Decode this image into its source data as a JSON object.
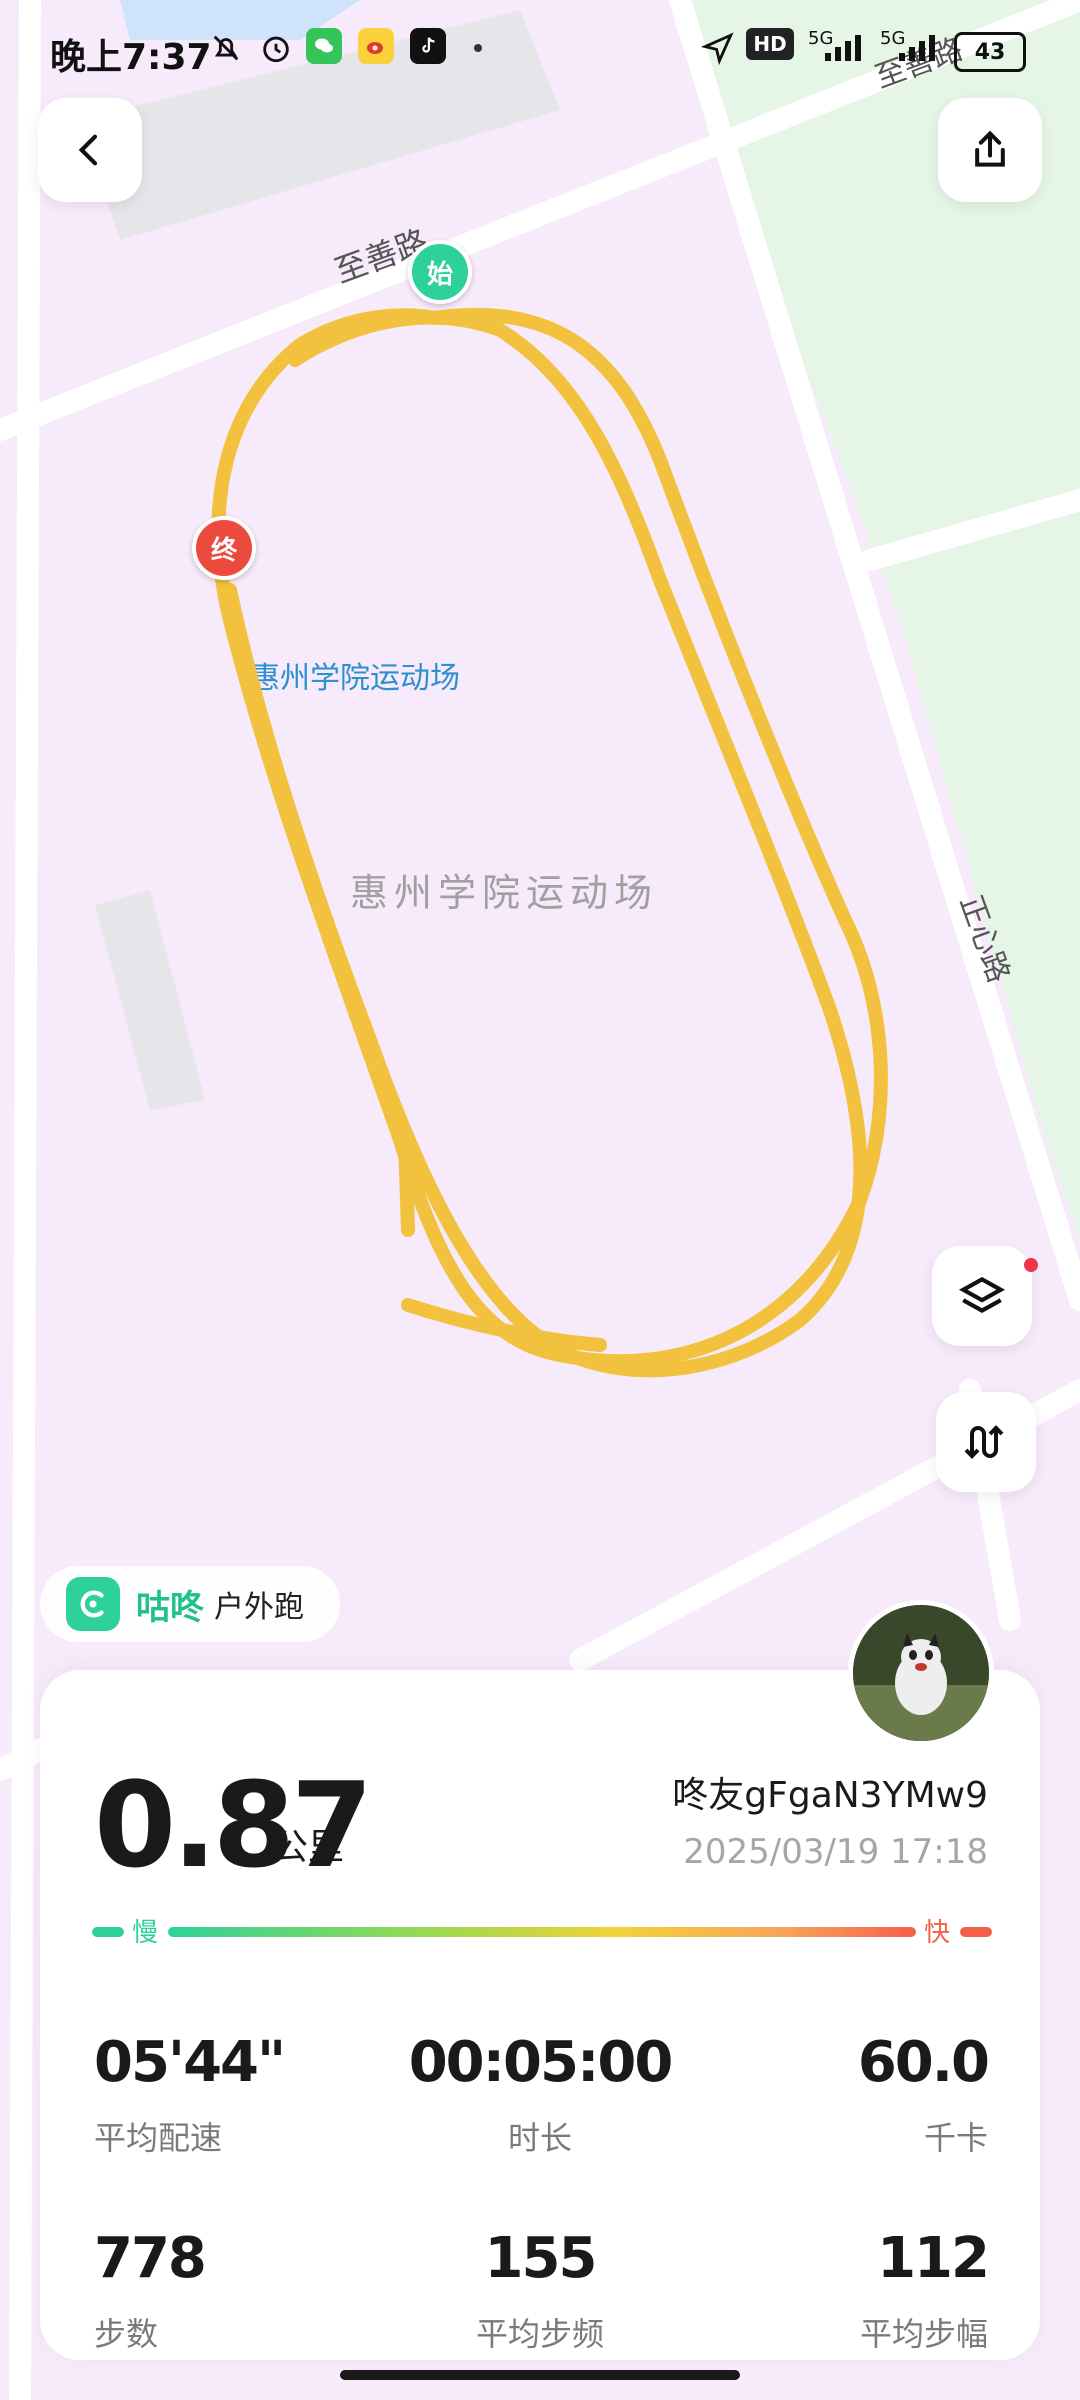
{
  "status_bar": {
    "time": "晚上7:37",
    "network_1": "5G",
    "network_2": "5G",
    "battery": "43"
  },
  "map": {
    "road_top": "至善路",
    "road_right": "正心路",
    "road_top_right": "至善路",
    "venue_label_blue": "惠州学院运动场",
    "venue_label_gray": "惠州学院运动场",
    "start_marker": "始",
    "end_marker": "终",
    "route_color": "#f2c13e"
  },
  "brand": {
    "name": "咕咚",
    "activity": "户外跑"
  },
  "summary": {
    "distance": "0.87",
    "distance_unit": "公里",
    "user": "咚友gFgaN3YMw9",
    "datetime": "2025/03/19 17:18",
    "pace_slow": "慢",
    "pace_fast": "快"
  },
  "stats": [
    {
      "value": "05'44\"",
      "label": "平均配速"
    },
    {
      "value": "00:05:00",
      "label": "时长"
    },
    {
      "value": "60.0",
      "label": "千卡"
    },
    {
      "value": "778",
      "label": "步数"
    },
    {
      "value": "155",
      "label": "平均步频"
    },
    {
      "value": "112",
      "label": "平均步幅"
    }
  ]
}
